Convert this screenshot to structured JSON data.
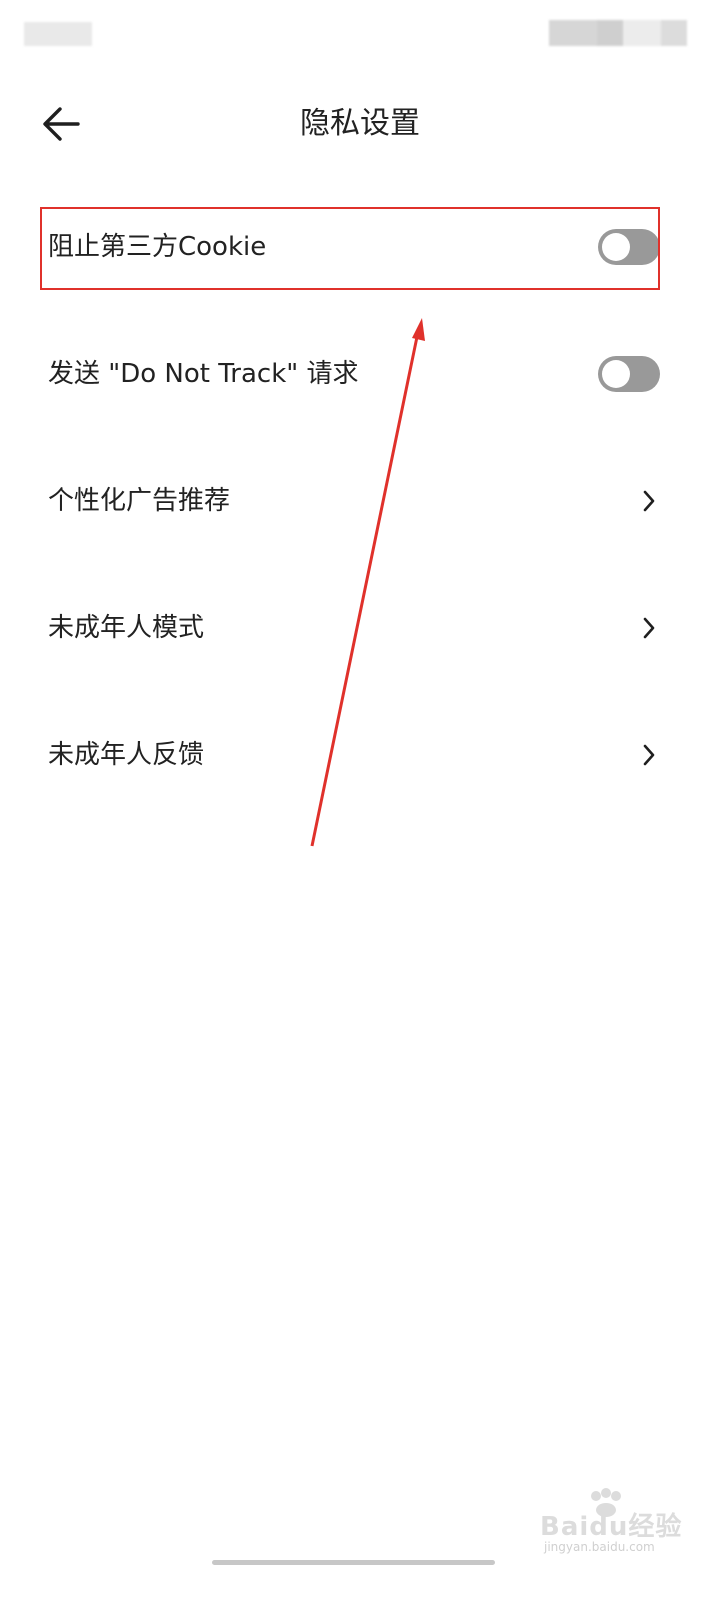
{
  "header": {
    "title": "隐私设置",
    "back_icon": "arrow-left-icon"
  },
  "settings": [
    {
      "label": "阻止第三方Cookie",
      "control": "toggle",
      "enabled": false
    },
    {
      "label": "发送 \"Do Not Track\" 请求",
      "control": "toggle",
      "enabled": false
    },
    {
      "label": "个性化广告推荐",
      "control": "chevron",
      "icon": "chevron-right-icon"
    },
    {
      "label": "未成年人模式",
      "control": "chevron",
      "icon": "chevron-right-icon"
    },
    {
      "label": "未成年人反馈",
      "control": "chevron",
      "icon": "chevron-right-icon"
    }
  ],
  "annotation": {
    "highlight_color": "#e0312b",
    "highlighted_item": "阻止第三方Cookie"
  },
  "watermark": {
    "text": "Baidu经验",
    "subtext": "jingyan.baidu.com"
  },
  "colors": {
    "toggle_off": "#999999",
    "text": "#222222",
    "background": "#ffffff"
  }
}
